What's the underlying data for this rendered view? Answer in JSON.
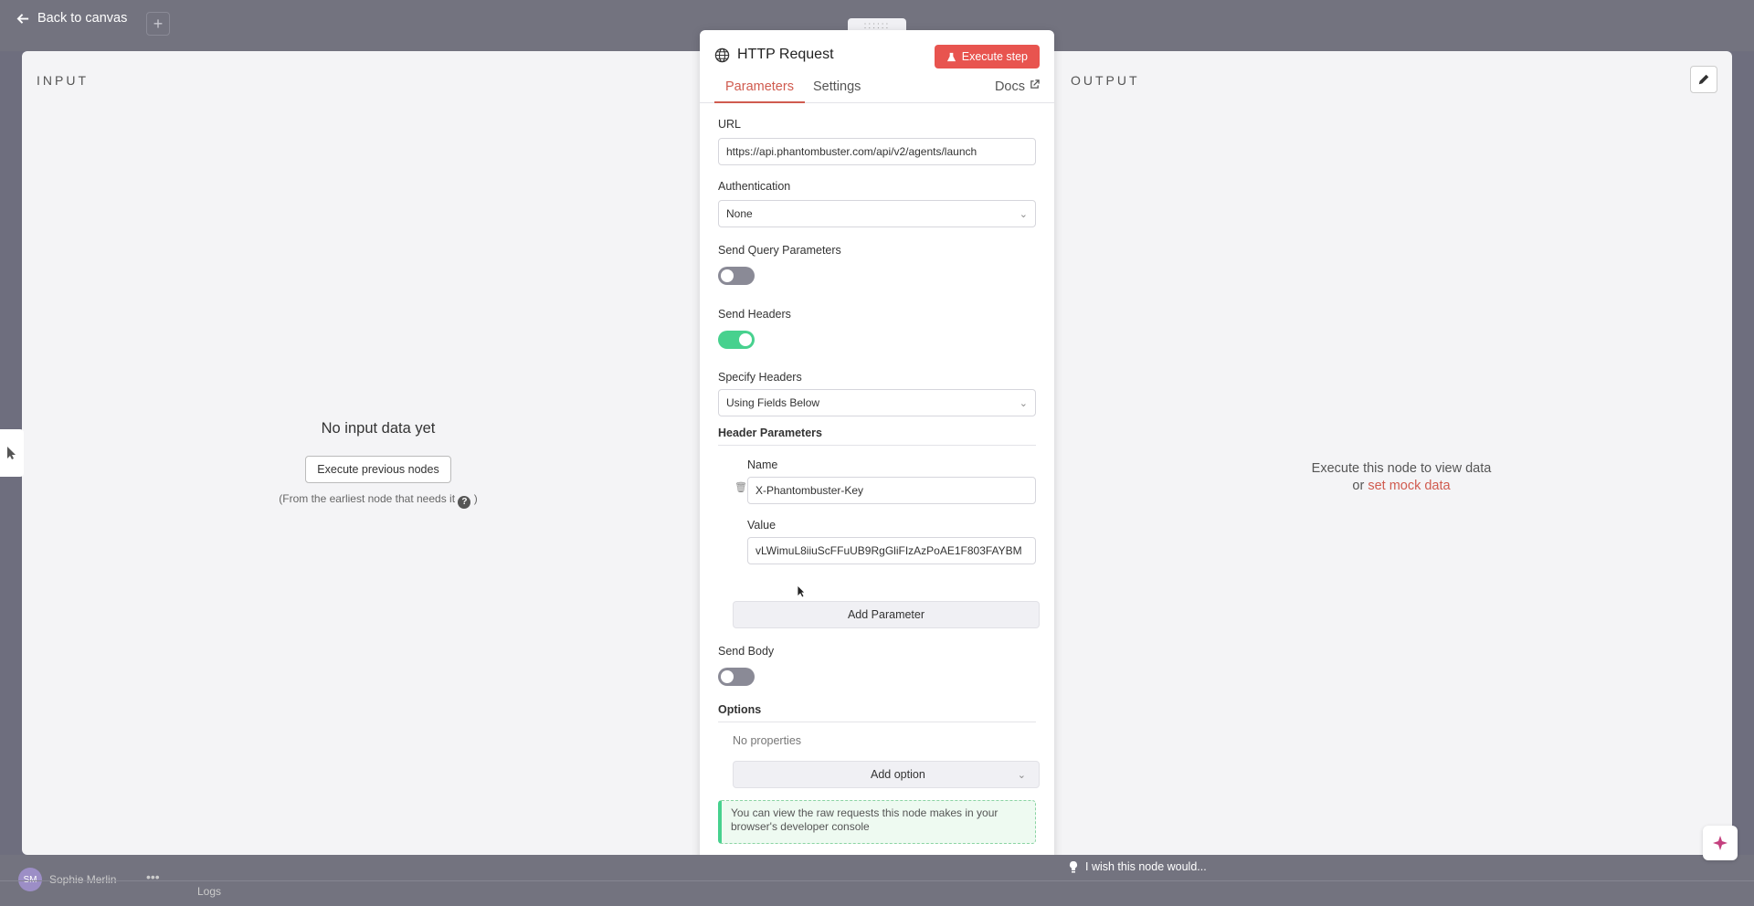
{
  "topbar": {
    "back_label": "Back to canvas",
    "plus_label": "+"
  },
  "input_pane": {
    "label": "INPUT",
    "empty_title": "No input data yet",
    "execute_previous_label": "Execute previous nodes",
    "note_prefix": "(From the earliest node that needs it",
    "note_suffix": ")",
    "help_glyph": "?"
  },
  "output_pane": {
    "label": "OUTPUT",
    "line1": "Execute this node to view data",
    "line2_prefix": "or",
    "mock_link": "set mock data"
  },
  "node": {
    "title": "HTTP Request",
    "execute_label": "Execute step",
    "drag_glyph": "::::::",
    "tabs": {
      "parameters": "Parameters",
      "settings": "Settings",
      "docs": "Docs"
    },
    "url_label": "URL",
    "url_value": "https://api.phantombuster.com/api/v2/agents/launch",
    "auth_label": "Authentication",
    "auth_value": "None",
    "query_label": "Send Query Parameters",
    "query_on": false,
    "headers_label": "Send Headers",
    "headers_on": true,
    "specify_label": "Specify Headers",
    "specify_value": "Using Fields Below",
    "header_params_label": "Header Parameters",
    "name_label": "Name",
    "name_value": "X-Phantombuster-Key",
    "value_label": "Value",
    "value_value": "vLWimuL8iiuScFFuUB9RgGliFIzAzPoAE1F803FAYBM",
    "add_param_label": "Add Parameter",
    "body_label": "Send Body",
    "body_on": false,
    "options_label": "Options",
    "no_props": "No properties",
    "add_option_label": "Add option",
    "notice": "You can view the raw requests this node makes in your browser's developer console"
  },
  "bottom": {
    "avatar_initials": "SM",
    "username": "Sophie Merlin",
    "more": "•••",
    "logs": "Logs",
    "wish": "I wish this node would..."
  },
  "colors": {
    "accent": "#d05b4f",
    "execute": "#e8544f",
    "toggle_on": "#47d18e",
    "toggle_off": "#8a8a96"
  }
}
